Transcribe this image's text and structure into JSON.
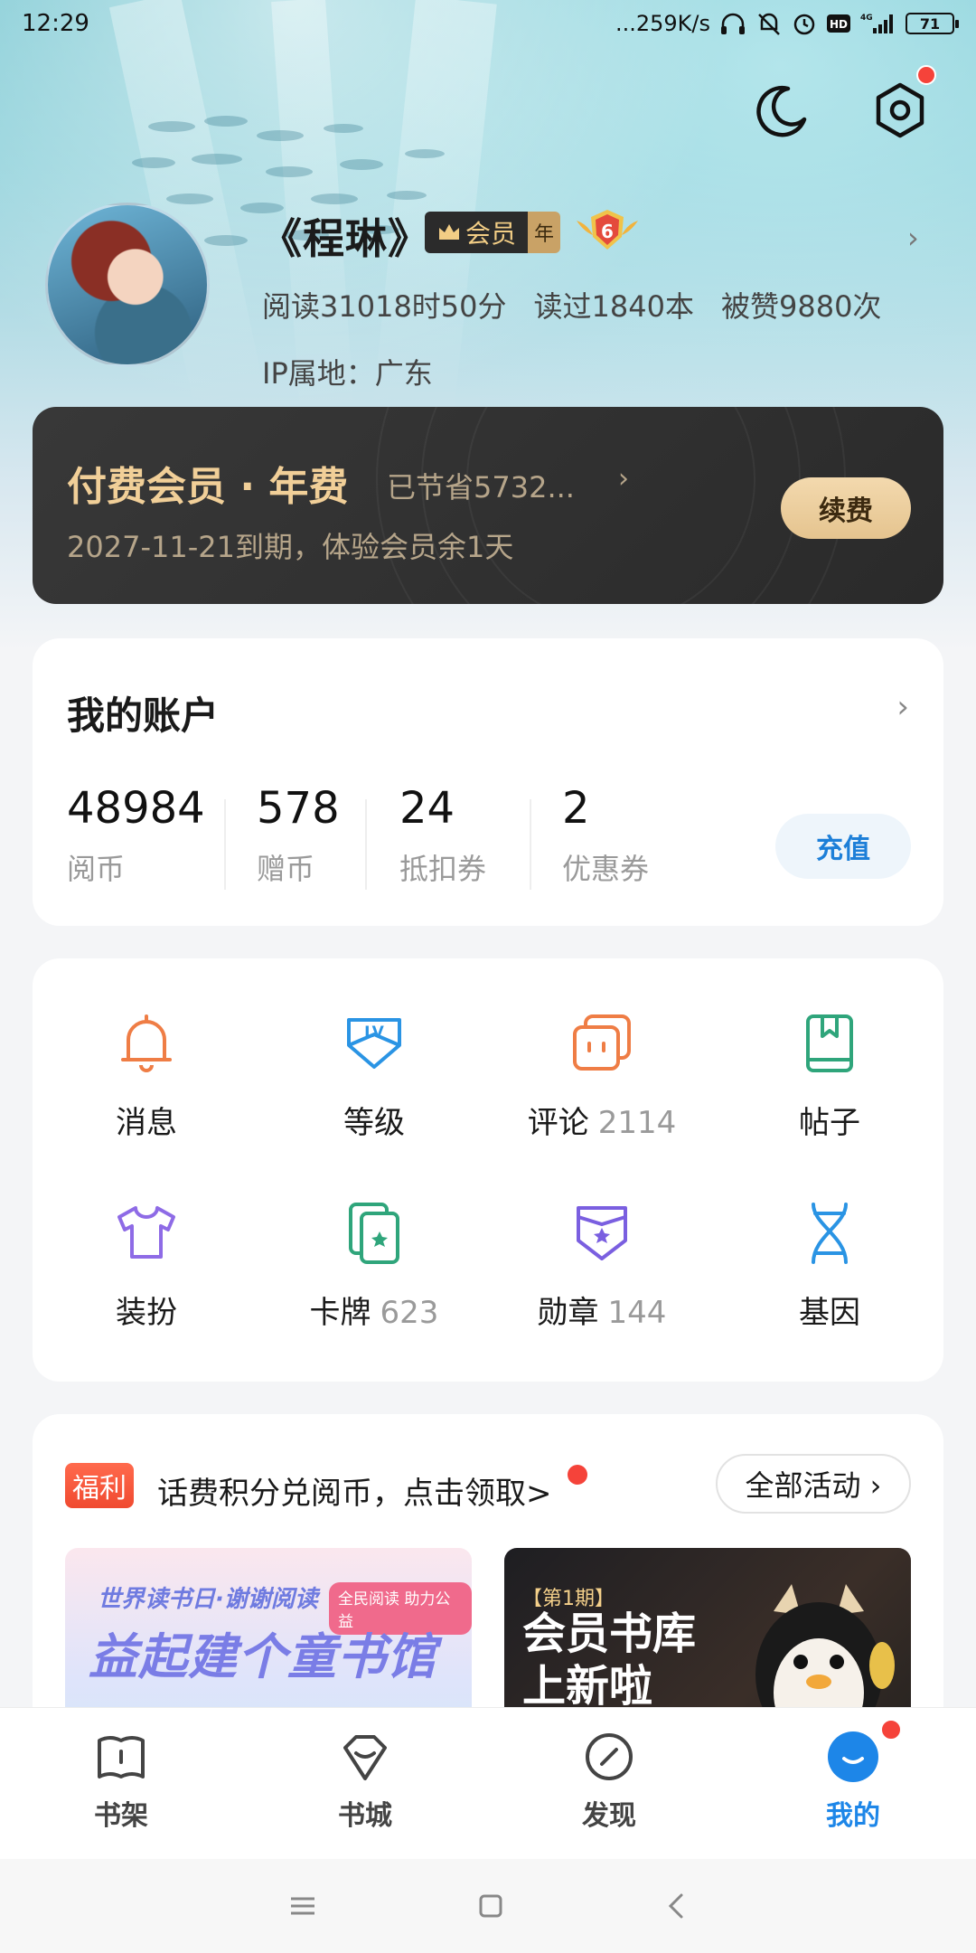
{
  "status_bar": {
    "time": "12:29",
    "net_speed": "...259K/s",
    "battery": "71",
    "network": "4G"
  },
  "profile": {
    "username": "《程琳》",
    "vip_label": "会员",
    "vip_year": "年",
    "level": "6",
    "reading_time": "阅读31018时50分",
    "books_read": "读过1840本",
    "likes": "被赞9880次",
    "ip_location": "IP属地：广东"
  },
  "member_card": {
    "title": "付费会员 · 年费",
    "saved": "已节省5732...",
    "expiry": "2027-11-21到期，体验会员余1天",
    "renew_label": "续费"
  },
  "account": {
    "title": "我的账户",
    "items": [
      {
        "value": "48984",
        "label": "阅币"
      },
      {
        "value": "578",
        "label": "赠币"
      },
      {
        "value": "24",
        "label": "抵扣券"
      },
      {
        "value": "2",
        "label": "优惠券"
      }
    ],
    "recharge_label": "充值"
  },
  "grid": {
    "items": [
      {
        "label": "消息",
        "count": "",
        "icon": "bell-icon",
        "color": "#ef7d45"
      },
      {
        "label": "等级",
        "count": "",
        "icon": "level-shield-icon",
        "color": "#2a94e4"
      },
      {
        "label": "评论",
        "count": "2114",
        "icon": "comment-icon",
        "color": "#ef7d45"
      },
      {
        "label": "帖子",
        "count": "",
        "icon": "post-book-icon",
        "color": "#2fa57b"
      },
      {
        "label": "装扮",
        "count": "",
        "icon": "tshirt-icon",
        "color": "#8e6be6"
      },
      {
        "label": "卡牌",
        "count": "623",
        "icon": "cards-icon",
        "color": "#2fa57b"
      },
      {
        "label": "勋章",
        "count": "144",
        "icon": "medal-icon",
        "color": "#7a5fe0"
      },
      {
        "label": "基因",
        "count": "",
        "icon": "dna-icon",
        "color": "#2a94e4"
      }
    ]
  },
  "welfare": {
    "tag": "福利",
    "text": "话费积分兑阅币，点击领取>",
    "all_activities": "全部活动 ›",
    "banners": [
      {
        "top_text": "世界读书日·谢谢阅读",
        "chip": "全民阅读 助力公益",
        "headline": "益起建个童书馆"
      },
      {
        "issue": "【第1期】",
        "headline_1": "会员书库",
        "headline_2": "上新啦"
      }
    ]
  },
  "bottom_nav": {
    "items": [
      {
        "label": "书架",
        "icon": "bookshelf-icon"
      },
      {
        "label": "书城",
        "icon": "bookstore-icon"
      },
      {
        "label": "发现",
        "icon": "discover-compass-icon"
      },
      {
        "label": "我的",
        "icon": "me-icon"
      }
    ],
    "active_index": 3,
    "accent": "#1d86e8"
  },
  "colors": {
    "alert_red": "#f5433a",
    "gold": "#f1cf98",
    "link_blue": "#1d7fd8"
  }
}
